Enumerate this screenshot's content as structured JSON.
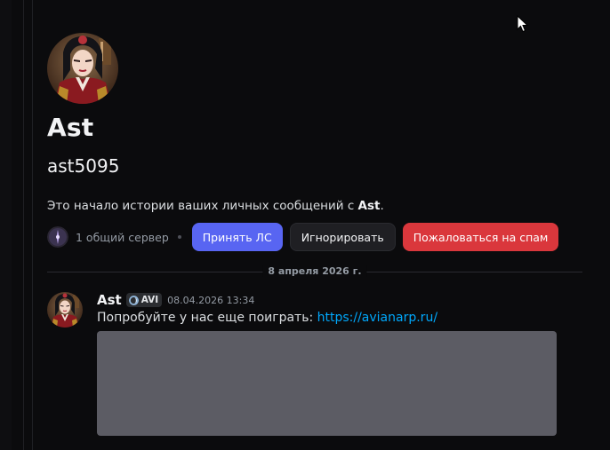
{
  "profile": {
    "display_name": "Ast",
    "username": "ast5095"
  },
  "intro": {
    "prefix": "Это начало истории ваших личных сообщений с ",
    "name": "Ast",
    "suffix": "."
  },
  "actions": {
    "mutual_servers": "1 общий сервер",
    "accept_label": "Принять ЛС",
    "ignore_label": "Игнорировать",
    "report_spam_label": "Пожаловаться на спам"
  },
  "date_separator": "8 апреля 2026 г.",
  "message": {
    "author": "Ast",
    "tag": "AVI",
    "timestamp": "08.04.2026 13:34",
    "text": "Попробуйте у нас еще поиграть: ",
    "link": "https://avianarp.ru/"
  },
  "colors": {
    "background": "#0b0b0d",
    "primary_button": "#5865f2",
    "danger_button": "#da373c",
    "link": "#00a8fc",
    "embed_placeholder": "#5c5c64"
  },
  "icons": {
    "avatar": "user-avatar",
    "server": "server-icon",
    "tag": "guild-tag-icon",
    "cursor": "mouse-pointer-icon"
  }
}
